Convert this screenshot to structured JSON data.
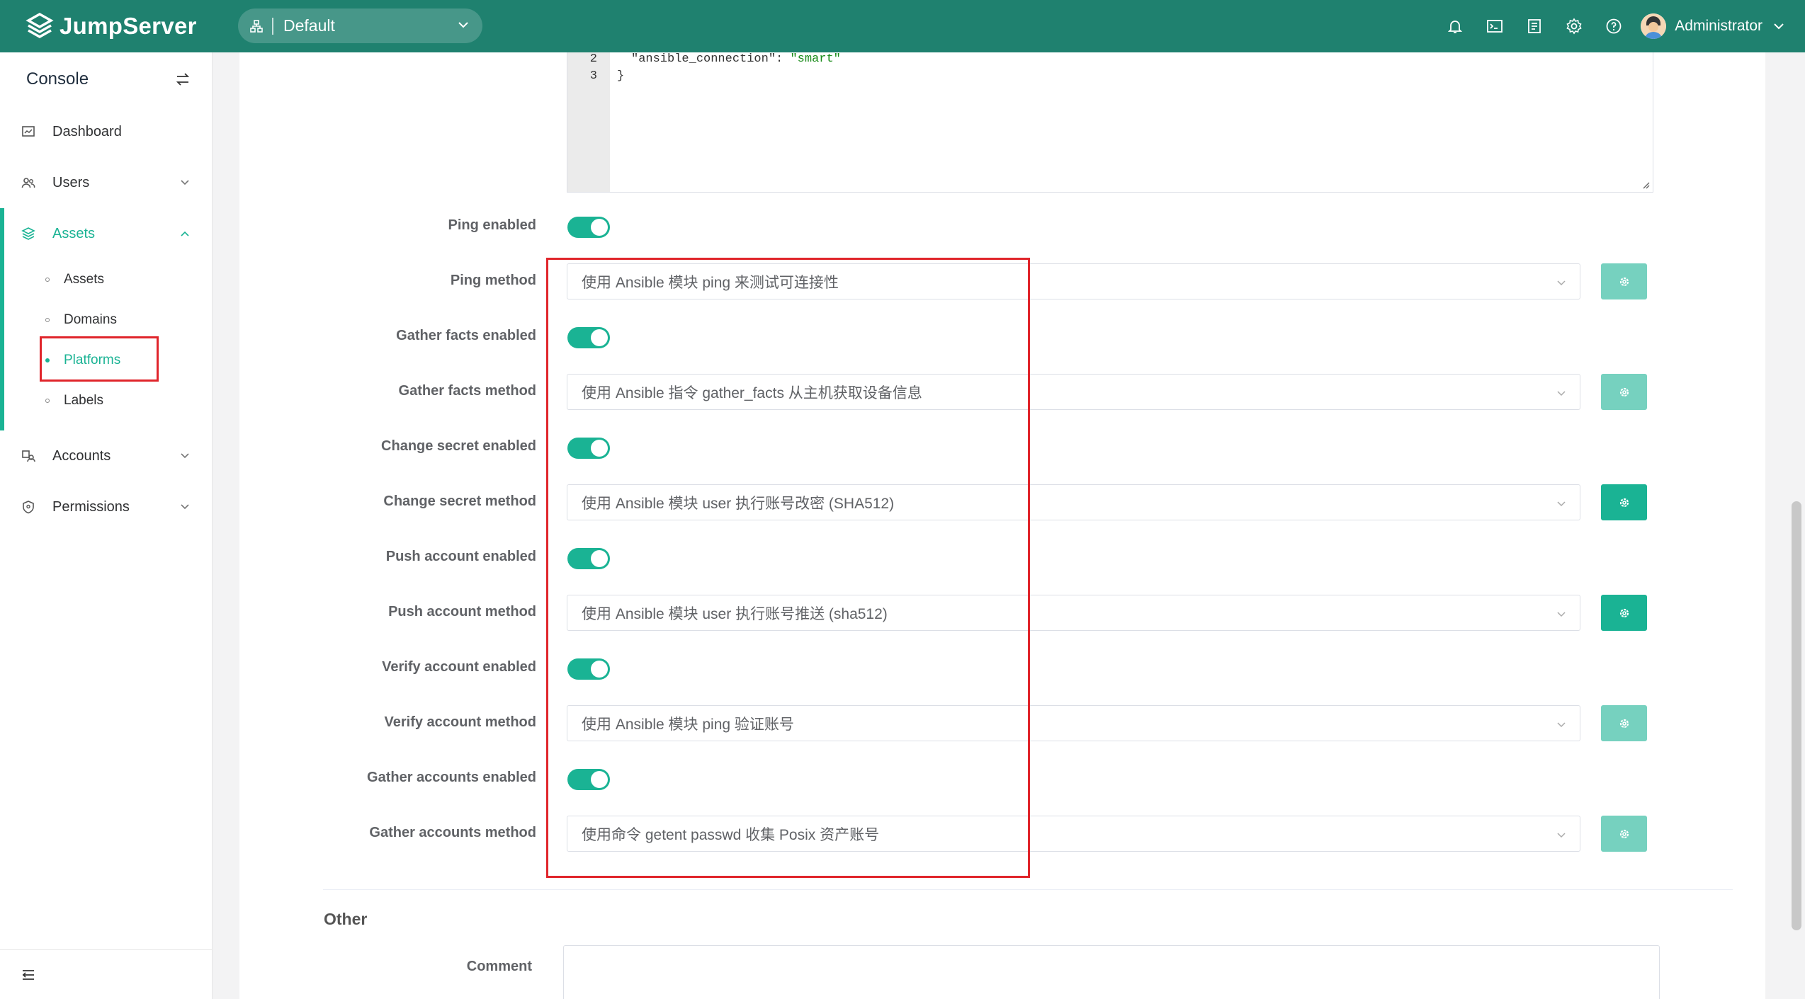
{
  "app": {
    "name": "JumpServer",
    "org_selector": "Default"
  },
  "header": {
    "icons": [
      "bell-icon",
      "terminal-icon",
      "tickets-icon",
      "settings-icon",
      "help-icon"
    ],
    "user_name": "Administrator"
  },
  "sidebar": {
    "title": "Console",
    "items": [
      {
        "label": "Dashboard",
        "icon": "dashboard-icon"
      },
      {
        "label": "Users",
        "icon": "users-icon"
      },
      {
        "label": "Assets",
        "icon": "assets-icon"
      },
      {
        "label": "Accounts",
        "icon": "accounts-icon"
      },
      {
        "label": "Permissions",
        "icon": "permissions-icon"
      }
    ],
    "assets_sub": [
      "Assets",
      "Domains",
      "Platforms",
      "Labels"
    ]
  },
  "editor": {
    "lines": [
      {
        "num": "2",
        "key": "\"ansible_connection\"",
        "sep": ": ",
        "value": "\"smart\""
      },
      {
        "num": "3",
        "text": "}"
      }
    ]
  },
  "form": {
    "rows": [
      {
        "label": "Ping enabled",
        "type": "toggle",
        "value": true
      },
      {
        "label": "Ping method",
        "type": "select",
        "value": "使用 Ansible 模块 ping 来测试可连接性",
        "button": "dim"
      },
      {
        "label": "Gather facts enabled",
        "type": "toggle",
        "value": true
      },
      {
        "label": "Gather facts method",
        "type": "select",
        "value": "使用 Ansible 指令 gather_facts 从主机获取设备信息",
        "button": "dim"
      },
      {
        "label": "Change secret enabled",
        "type": "toggle",
        "value": true
      },
      {
        "label": "Change secret method",
        "type": "select",
        "value": "使用 Ansible 模块 user 执行账号改密 (SHA512)",
        "button": "solid"
      },
      {
        "label": "Push account enabled",
        "type": "toggle",
        "value": true
      },
      {
        "label": "Push account method",
        "type": "select",
        "value": "使用 Ansible 模块 user 执行账号推送 (sha512)",
        "button": "solid"
      },
      {
        "label": "Verify account enabled",
        "type": "toggle",
        "value": true
      },
      {
        "label": "Verify account method",
        "type": "select",
        "value": "使用 Ansible 模块 ping 验证账号",
        "button": "dim"
      },
      {
        "label": "Gather accounts enabled",
        "type": "toggle",
        "value": true
      },
      {
        "label": "Gather accounts method",
        "type": "select",
        "value": "使用命令 getent passwd 收集 Posix 资产账号",
        "button": "dim"
      }
    ],
    "other_section": "Other",
    "comment_label": "Comment"
  },
  "colors": {
    "header": "#1f816f",
    "accent": "#1ab394",
    "highlight": "#e0252b"
  }
}
